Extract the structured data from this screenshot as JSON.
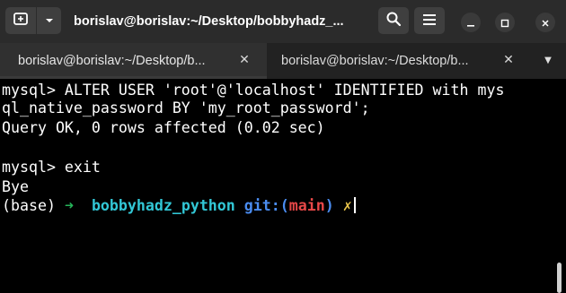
{
  "window": {
    "title": "borislav@borislav:~/Desktop/bobbyhadz_..."
  },
  "header": {
    "buttons": {
      "new_tab_icon": "new-tab-icon",
      "tab_menu_icon": "chevron-down-icon",
      "search_icon": "search-icon",
      "menu_icon": "hamburger-menu-icon",
      "minimize_icon": "minimize-icon",
      "maximize_icon": "maximize-icon",
      "close_icon": "close-icon"
    }
  },
  "tabs": [
    {
      "label": "borislav@borislav:~/Desktop/b...",
      "active": true
    },
    {
      "label": "borislav@borislav:~/Desktop/b...",
      "active": false
    }
  ],
  "terminal": {
    "lines": [
      "mysql> ALTER USER 'root'@'localhost' IDENTIFIED with mys",
      "ql_native_password BY 'my_root_password';",
      "Query OK, 0 rows affected (0.02 sec)",
      "",
      "mysql> exit",
      "Bye"
    ],
    "prompt": {
      "env": "(base)",
      "arrow": "➜",
      "dir": "bobbyhadz_python",
      "git_label": "git:(",
      "branch": "main",
      "git_close": ")",
      "dirty": "✗"
    }
  },
  "colors": {
    "headerbar": "#2b2b2b",
    "tabbar": "#222222",
    "active_tab": "#303030",
    "terminal_bg": "#000000",
    "arrow": "#26b55a",
    "dir": "#32c7d6",
    "git": "#4a8cf0",
    "branch": "#e84848",
    "dirty": "#e9c54a"
  }
}
